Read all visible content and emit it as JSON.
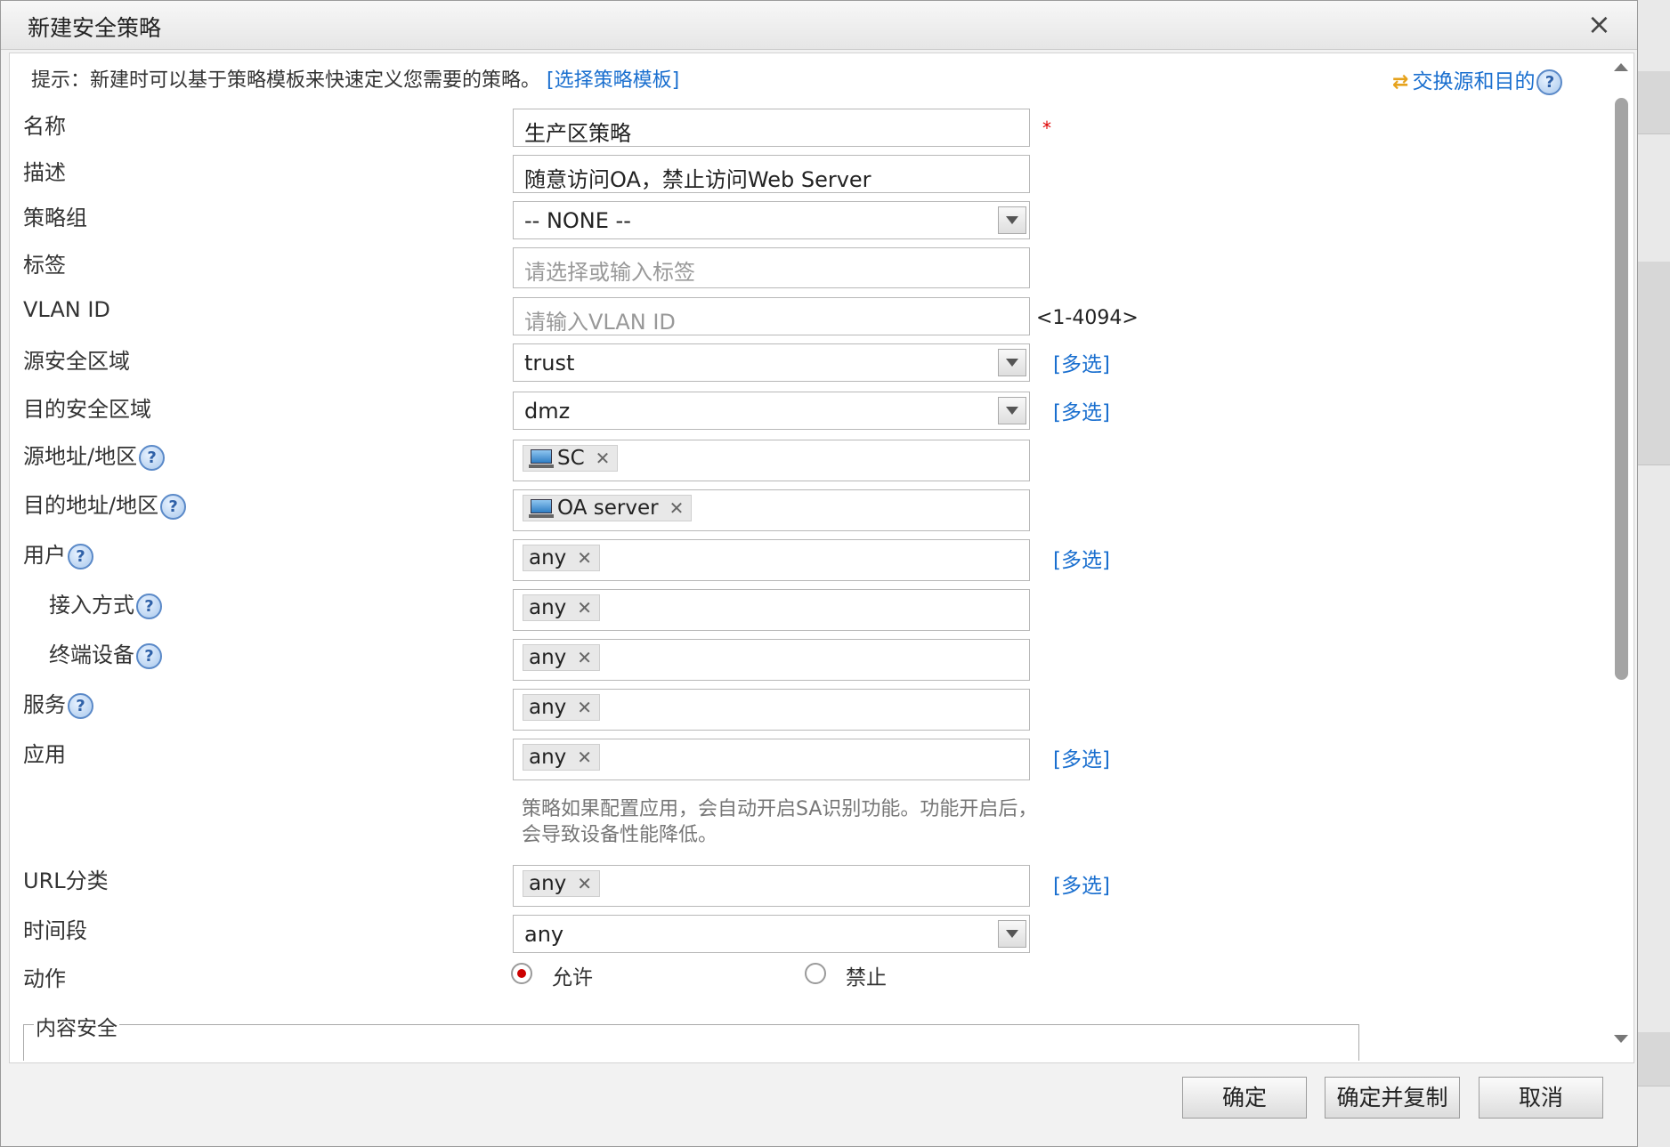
{
  "dialog": {
    "title": "新建安全策略",
    "close_glyph": "×",
    "hint": "提示：新建时可以基于策略模板来快速定义您需要的策略。",
    "hint_link": "[选择策略模板]",
    "swap_label": "交换源和目的",
    "swap_icon": "swap-arrows-icon"
  },
  "form": {
    "name": {
      "label": "名称",
      "value": "生产区策略",
      "required": "*"
    },
    "desc": {
      "label": "描述",
      "value": "随意访问OA，禁止访问Web Server"
    },
    "group": {
      "label": "策略组",
      "value": "-- NONE --"
    },
    "tags": {
      "label": "标签",
      "placeholder": "请选择或输入标签"
    },
    "vlan": {
      "label": "VLAN ID",
      "placeholder": "请输入VLAN ID",
      "range": "<1-4094>"
    },
    "src_zone": {
      "label": "源安全区域",
      "value": "trust",
      "multi": "[多选]"
    },
    "dst_zone": {
      "label": "目的安全区域",
      "value": "dmz",
      "multi": "[多选]"
    },
    "src_addr": {
      "label": "源地址/地区",
      "tag": "SC"
    },
    "dst_addr": {
      "label": "目的地址/地区",
      "tag": "OA server"
    },
    "user": {
      "label": "用户",
      "tag": "any",
      "multi": "[多选]"
    },
    "access": {
      "label": "接入方式",
      "tag": "any"
    },
    "device": {
      "label": "终端设备",
      "tag": "any"
    },
    "service": {
      "label": "服务",
      "tag": "any"
    },
    "app": {
      "label": "应用",
      "tag": "any",
      "multi": "[多选]",
      "note": "策略如果配置应用，会自动开启SA识别功能。功能开启后，会导致设备性能降低。"
    },
    "url": {
      "label": "URL分类",
      "tag": "any",
      "multi": "[多选]"
    },
    "time": {
      "label": "时间段",
      "value": "any"
    },
    "action": {
      "label": "动作",
      "allow": "允许",
      "deny": "禁止",
      "selected": "允许"
    },
    "content_security": {
      "legend": "内容安全"
    }
  },
  "help_glyph": "?",
  "tag_close_glyph": "✕",
  "footer": {
    "ok": "确定",
    "ok_copy": "确定并复制",
    "cancel": "取消"
  },
  "colors": {
    "link": "#1a6fcf",
    "required": "#dd0000",
    "radio_selected": "#cc0000"
  }
}
